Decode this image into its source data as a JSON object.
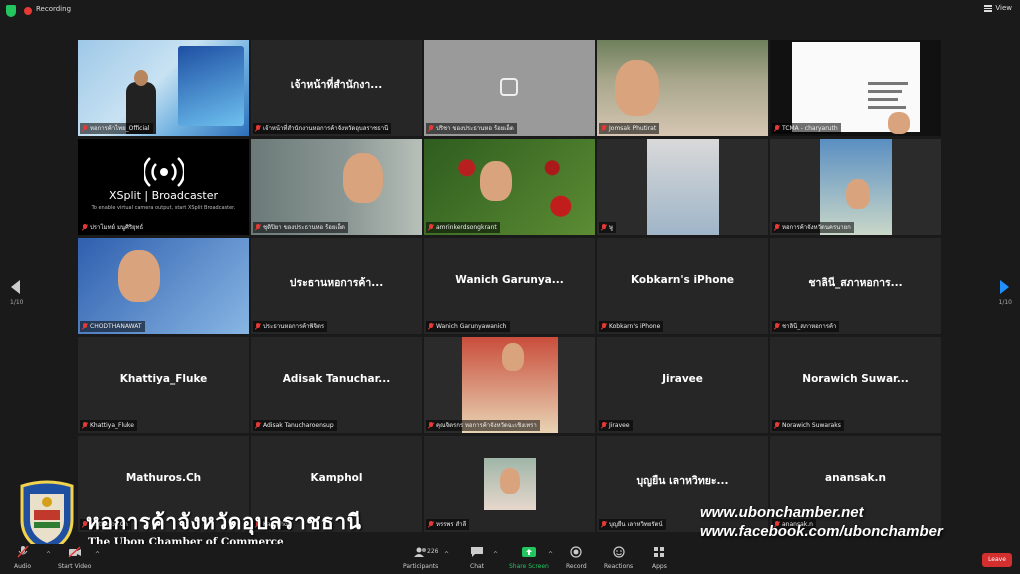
{
  "topbar": {
    "recording_label": "Recording",
    "view_label": "View"
  },
  "pagination": {
    "left": "1/10",
    "right": "1/10"
  },
  "tiles": [
    {
      "display_name": "",
      "label": "หอการค้าไทย_Official",
      "video": "stage",
      "active": true
    },
    {
      "display_name": "เจ้าหน้าที่สำนักงา...",
      "label": "เจ้าหน้าที่สำนักงานหอการค้าจังหวัดอุบลราชธานี",
      "video": "none"
    },
    {
      "display_name": "",
      "label": "ปริชา ของประธานหอ ร้อยเอ็ด",
      "video": "gray"
    },
    {
      "display_name": "",
      "label": "Jomsak Phutirat",
      "video": "red"
    },
    {
      "display_name": "",
      "label": "TCMA - charyaruth",
      "video": "slides"
    },
    {
      "display_name": "",
      "label": "ปราโมทย์ มนูศิริยุทธ์",
      "video": "xsplit"
    },
    {
      "display_name": "",
      "label": "ชุติปิยา ของประธานหอ ร้อยเอ็ด",
      "video": "woman"
    },
    {
      "display_name": "",
      "label": "amrinkerdsongkrant",
      "video": "coffee"
    },
    {
      "display_name": "",
      "label": "ษู",
      "video": "dark"
    },
    {
      "display_name": "",
      "label": "หอการค้าจังหวัดนครนายก",
      "video": "mask"
    },
    {
      "display_name": "",
      "label": "CHODTHANAWAT",
      "video": "suit"
    },
    {
      "display_name": "ประธานหอการค้า...",
      "label": "ประธานหอการค้าพิจิตร",
      "video": "none"
    },
    {
      "display_name": "Wanich Garunya...",
      "label": "Wanich Garunyawanich",
      "video": "none"
    },
    {
      "display_name": "Kobkarn's iPhone",
      "label": "Kobkarn's iPhone",
      "video": "none"
    },
    {
      "display_name": "ชาลินี_สภาหอการ...",
      "label": "ชาลินี_สภาหอการค้า",
      "video": "none"
    },
    {
      "display_name": "Khattiya_Fluke",
      "label": "Khattiya_Fluke",
      "video": "none"
    },
    {
      "display_name": "Adisak Tanuchar...",
      "label": "Adisak Tanucharoensup",
      "video": "none"
    },
    {
      "display_name": "",
      "label": "คุณจิตรกร หอการค้าจังหวัดฉะเชิงเทรา",
      "video": "cert"
    },
    {
      "display_name": "Jiravee",
      "label": "Jiravee",
      "video": "none"
    },
    {
      "display_name": "Norawich Suwar...",
      "label": "Norawich Suwaraks",
      "video": "none"
    },
    {
      "display_name": "Mathuros.Ch",
      "label": "Mathuros.Ch",
      "video": "none"
    },
    {
      "display_name": "Kamphol",
      "label": "Kamphol",
      "video": "none"
    },
    {
      "display_name": "",
      "label": "หรรพร สำลี",
      "video": "selfie"
    },
    {
      "display_name": "บุญยืน เลาหวิทยะ...",
      "label": "บุญยืน เลาหวิทยรัตน์",
      "video": "none"
    },
    {
      "display_name": "anansak.n",
      "label": "anansak.n",
      "video": "none"
    }
  ],
  "xsplit": {
    "title": "XSplit | Broadcaster",
    "subtitle": "To enable virtual camera output, start XSplit Broadcaster."
  },
  "watermark": {
    "thai": "หอการค้าจังหวัดอุบลราชธานี",
    "english": "The Ubon Chamber of Commerce",
    "url1": "www.ubonchamber.net",
    "url2": "www.facebook.com/ubonchamber"
  },
  "toolbar": {
    "audio": "Audio",
    "start_video": "Start Video",
    "participants": "Participants",
    "participants_count": "226",
    "chat": "Chat",
    "share_screen": "Share Screen",
    "record": "Record",
    "reactions": "Reactions",
    "apps": "Apps",
    "leave": "Leave"
  },
  "colors": {
    "active_outline": "#b7e34a",
    "share_green": "#22c55e",
    "leave_red": "#d32f2f",
    "next_arrow": "#1e90ff"
  }
}
